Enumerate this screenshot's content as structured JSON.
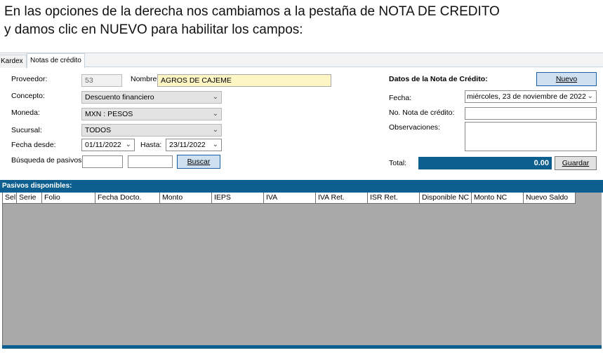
{
  "instruction": {
    "line1": "En las opciones de la derecha nos cambiamos a la pestaña de NOTA DE CREDITO",
    "line2": "y damos clic en NUEVO para habilitar los campos:"
  },
  "tabs": [
    {
      "label": "Kardex",
      "active": false
    },
    {
      "label": "Notas de crédito",
      "active": true
    }
  ],
  "left_form": {
    "proveedor_label": "Proveedor:",
    "proveedor_value": "53",
    "nombre_label": "Nombre:",
    "nombre_value": "AGROS DE CAJEME",
    "concepto_label": "Concepto:",
    "concepto_value": "Descuento financiero",
    "moneda_label": "Moneda:",
    "moneda_value": "MXN : PESOS",
    "sucursal_label": "Sucursal:",
    "sucursal_value": "TODOS",
    "fecha_desde_label": "Fecha desde:",
    "fecha_desde_value": "01/11/2022",
    "hasta_label": "Hasta:",
    "hasta_value": "23/11/2022",
    "busqueda_label": "Búsqueda de pasivos:",
    "busqueda_value1": "",
    "busqueda_value2": "",
    "buscar_button": "Buscar"
  },
  "right_form": {
    "section_title": "Datos de la Nota de Crédito:",
    "nuevo_button": "Nuevo",
    "fecha_label": "Fecha:",
    "fecha_value": "miércoles, 23 de noviembre de 2022",
    "no_nota_label": "No. Nota de crédito:",
    "no_nota_value": "",
    "observaciones_label": "Observaciones:",
    "observaciones_value": "",
    "total_label": "Total:",
    "total_value": "0.00",
    "guardar_button": "Guardar"
  },
  "grid": {
    "title": "Pasivos disponibles:",
    "columns": [
      "Sel.",
      "Serie",
      "Folio",
      "Fecha Docto.",
      "Monto",
      "IEPS",
      "IVA",
      "IVA Ret.",
      "ISR Ret.",
      "Disponible NC",
      "Monto NC",
      "Nuevo Saldo"
    ]
  },
  "colors": {
    "accent_blue": "#0d5f8f",
    "grid_background": "#a9a9a9",
    "highlight_yellow": "#fdf6c4"
  }
}
